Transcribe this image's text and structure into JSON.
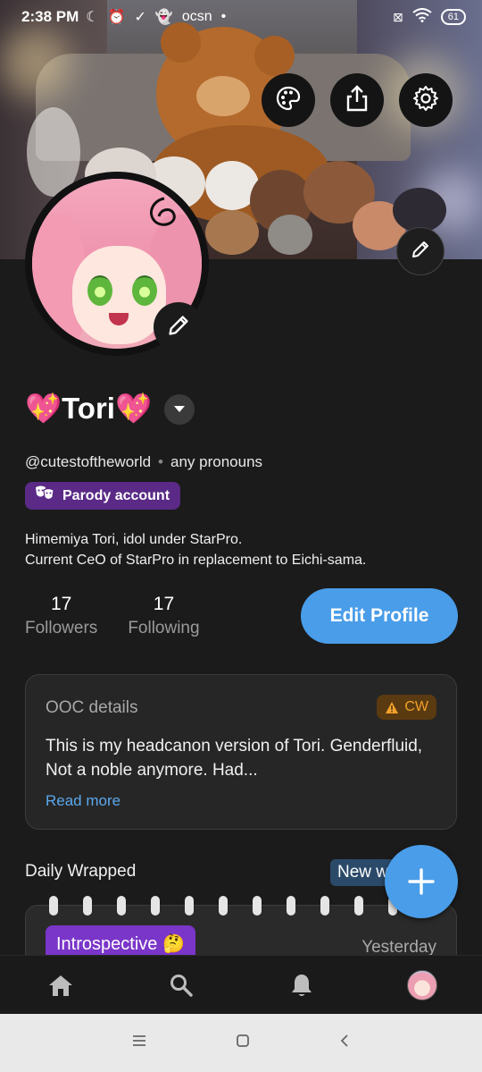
{
  "status_bar": {
    "time": "2:38 PM",
    "carrier_text": "ocsn",
    "battery": "61"
  },
  "profile": {
    "display_name": "💖Tori💖",
    "handle": "@cutestoftheworld",
    "pronouns": "any pronouns",
    "badge": "Parody account",
    "bio_line1": "Himemiya Tori, idol under StarPro.",
    "bio_line2": "Current CeO of StarPro in replacement to Eichi-sama.",
    "followers_count": "17",
    "followers_label": "Followers",
    "following_count": "17",
    "following_label": "Following",
    "edit_button": "Edit Profile"
  },
  "ooc": {
    "title": "OOC details",
    "cw_label": "CW",
    "text": "This is my headcanon version of Tori. Genderfluid, Not a noble anymore. Had...",
    "read_more": "Read more"
  },
  "daily_wrapped": {
    "title": "Daily Wrapped",
    "new_badge": "New w",
    "mood_tag": "Introspective 🤔",
    "date": "Yesterday"
  },
  "icons": {
    "palette": "palette-icon",
    "share": "share-icon",
    "settings": "gear-icon",
    "edit": "pencil-icon",
    "home": "home-icon",
    "search": "search-icon",
    "notifications": "bell-icon",
    "fab": "plus-icon"
  },
  "colors": {
    "accent": "#4a9de8",
    "parody_badge": "#5a2a86",
    "cw_text": "#f2a12a",
    "mood_tag": "#7a35c9"
  }
}
